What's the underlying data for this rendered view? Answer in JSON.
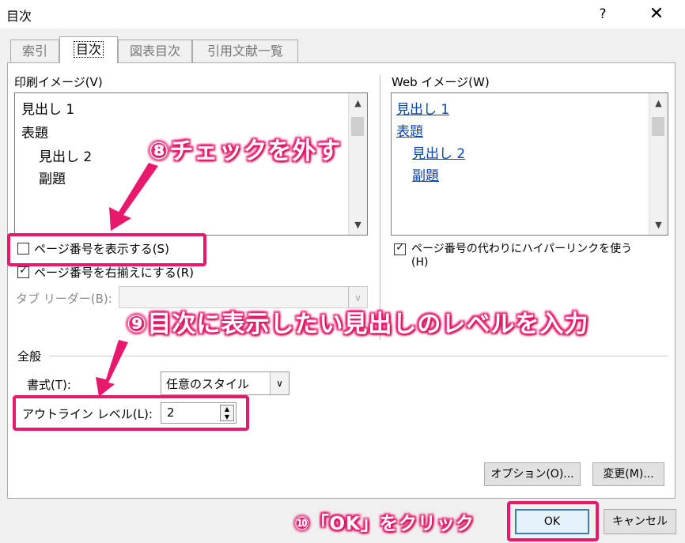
{
  "window": {
    "title": "目次",
    "help": "?",
    "close": "✕"
  },
  "tabs": [
    {
      "label": "索引",
      "active": false
    },
    {
      "label": "目次",
      "active": true
    },
    {
      "label": "図表目次",
      "active": false
    },
    {
      "label": "引用文献一覧",
      "active": false
    }
  ],
  "print_preview": {
    "label": "印刷イメージ(V)",
    "lines": [
      "見出し 1",
      "表題",
      "見出し 2",
      "副題"
    ]
  },
  "web_preview": {
    "label": "Web イメージ(W)",
    "lines": [
      "見出し 1",
      "表題",
      "見出し 2",
      "副題"
    ]
  },
  "options": {
    "show_page_numbers": {
      "label": "ページ番号を表示する(S)",
      "checked": false
    },
    "right_align": {
      "label": "ページ番号を右揃えにする(R)",
      "checked": true
    },
    "tab_leader": {
      "label": "タブ リーダー(B):",
      "value": ""
    },
    "use_hyperlinks": {
      "label_line1": "ページ番号の代わりにハイパーリンクを使う",
      "label_line2": "(H)",
      "checked": true
    }
  },
  "general": {
    "heading": "全般",
    "format": {
      "label": "書式(T):",
      "value": "任意のスタイル"
    },
    "outline_level": {
      "label": "アウトライン レベル(L):",
      "value": "2"
    }
  },
  "buttons": {
    "options": "オプション(O)...",
    "modify": "変更(M)...",
    "ok": "OK",
    "cancel": "キャンセル"
  },
  "annotations": {
    "step8": "⑧チェックを外す",
    "step9": "⑨目次に表示したい見出しのレベルを入力",
    "step10": "⑩「OK」をクリック"
  },
  "colors": {
    "highlight": "#e8196b",
    "link": "#0645ad",
    "ok_border": "#3c7fb1"
  }
}
